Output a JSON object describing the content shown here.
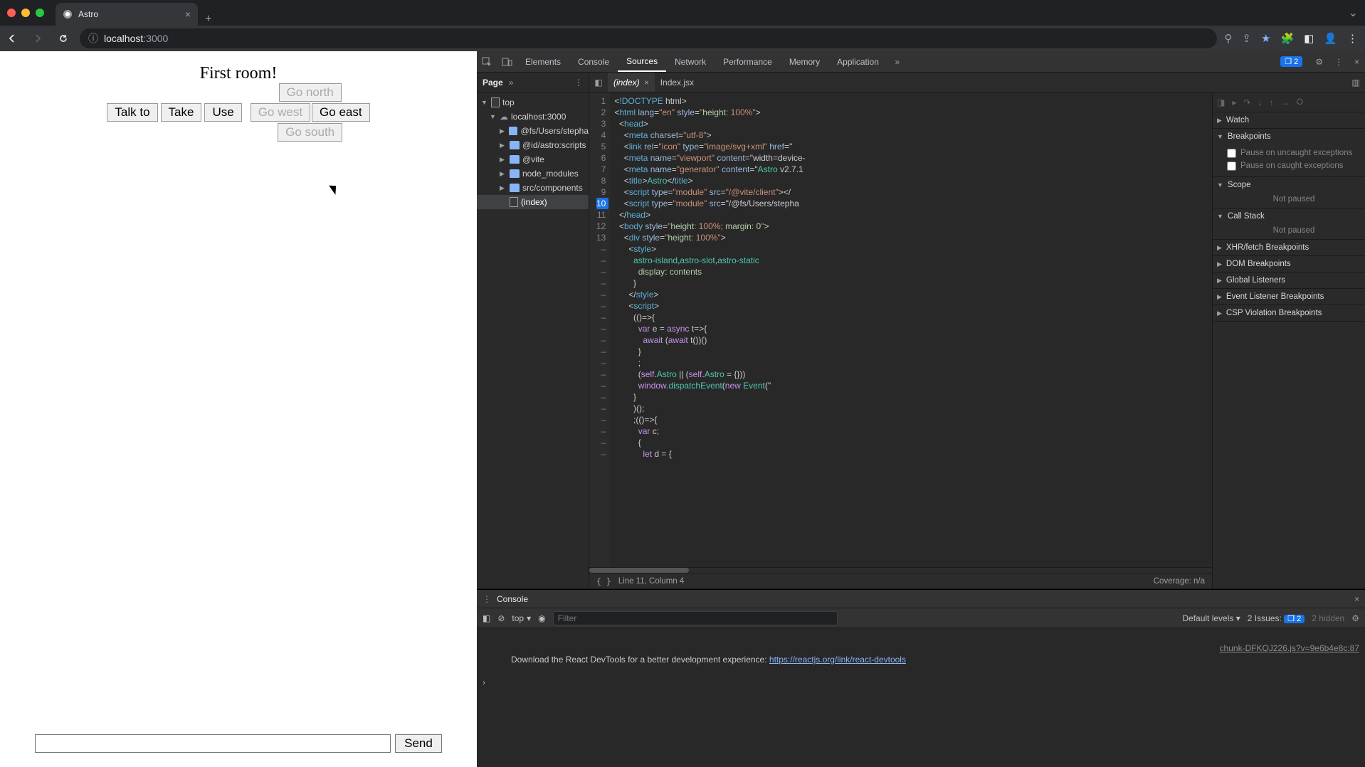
{
  "browser": {
    "tab_title": "Astro",
    "url_host": "localhost",
    "url_port": ":3000"
  },
  "game": {
    "room_title": "First room!",
    "actions": {
      "talk": "Talk to",
      "take": "Take",
      "use": "Use"
    },
    "dirs": {
      "north": "Go north",
      "west": "Go west",
      "east": "Go east",
      "south": "Go south"
    },
    "send": "Send"
  },
  "devtools": {
    "tabs": {
      "elements": "Elements",
      "console": "Console",
      "sources": "Sources",
      "network": "Network",
      "performance": "Performance",
      "memory": "Memory",
      "application": "Application"
    },
    "issues_count": "2",
    "navigator_tab": "Page",
    "tree": {
      "top": "top",
      "host": "localhost:3000",
      "fs": "@fs/Users/stepha",
      "astro_scripts": "@id/astro:scripts",
      "vite": "@vite",
      "node_modules": "node_modules",
      "src_components": "src/components",
      "index": "(index)"
    },
    "editor_tabs": {
      "index": "(index)",
      "indexjsx": "Index.jsx"
    },
    "breakpoint_line": "10",
    "source_lines": [
      "<!DOCTYPE html>",
      "<html lang=\"en\" style=\"height: 100%\">",
      "  <head>",
      "    <meta charset=\"utf-8\">",
      "    <link rel=\"icon\" type=\"image/svg+xml\" href=\"",
      "    <meta name=\"viewport\" content=\"width=device-",
      "    <meta name=\"generator\" content=\"Astro v2.7.1",
      "    <title>Astro</title>",
      "    <script type=\"module\" src=\"/@vite/client\"></",
      "    <script type=\"module\" src=\"/@fs/Users/stepha",
      "  </head>",
      "  <body style=\"height: 100%; margin: 0\">",
      "    <div style=\"height: 100%\">",
      "      <style>",
      "        astro-island,astro-slot,astro-static",
      "          display: contents",
      "        }",
      "      </style>",
      "      <script>",
      "        (()=>{",
      "          var e = async t=>{",
      "            await (await t())()",
      "          }",
      "          ;",
      "          (self.Astro || (self.Astro = {})) ",
      "          window.dispatchEvent(new Event(\"",
      "        }",
      "        )();",
      "        ;(()=>{",
      "          var c;",
      "          {",
      "            let d = {"
    ],
    "status": {
      "prettyprint": "{ }",
      "cursor": "Line 11, Column 4",
      "coverage": "Coverage: n/a"
    },
    "watch": {
      "watch_label": "Watch",
      "breakpoints_label": "Breakpoints",
      "bp_uncaught": "Pause on uncaught exceptions",
      "bp_caught": "Pause on caught exceptions",
      "scope_label": "Scope",
      "not_paused": "Not paused",
      "callstack_label": "Call Stack",
      "xhr_label": "XHR/fetch Breakpoints",
      "dom_label": "DOM Breakpoints",
      "global_label": "Global Listeners",
      "event_label": "Event Listener Breakpoints",
      "csp_label": "CSP Violation Breakpoints"
    }
  },
  "console": {
    "title": "Console",
    "context": "top",
    "filter_placeholder": "Filter",
    "levels": "Default levels",
    "issues_label": "2 Issues:",
    "issues_count": "2",
    "hidden": "2 hidden",
    "source_file": "chunk-DFKQJ226.js?v=9e6b4e8c:87",
    "message": "Download the React DevTools for a better development experience: ",
    "link": "https://reactjs.org/link/react-devtools"
  }
}
